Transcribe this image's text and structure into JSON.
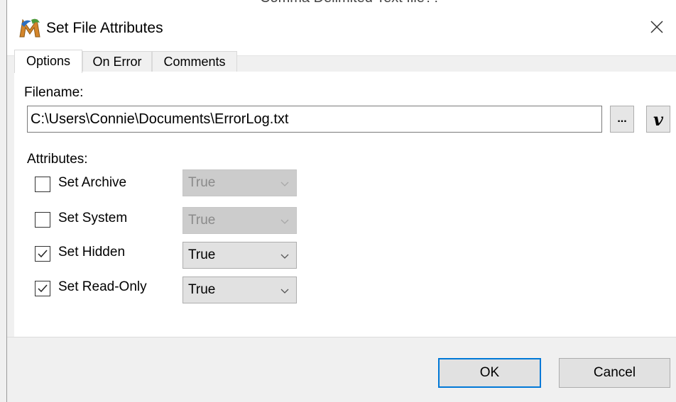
{
  "window": {
    "title": "Set File Attributes",
    "behind_text": "Comma Delimited Text file??"
  },
  "tabs": [
    {
      "label": "Options",
      "active": true
    },
    {
      "label": "On Error",
      "active": false
    },
    {
      "label": "Comments",
      "active": false
    }
  ],
  "filename": {
    "label": "Filename:",
    "value": "C:\\Users\\Connie\\Documents\\ErrorLog.txt",
    "browse_label": "...",
    "variable_label": "v"
  },
  "attributes": {
    "label": "Attributes:",
    "items": [
      {
        "label": "Set Archive",
        "checked": false,
        "value": "True",
        "enabled": false
      },
      {
        "label": "Set System",
        "checked": false,
        "value": "True",
        "enabled": false
      },
      {
        "label": "Set Hidden",
        "checked": true,
        "value": "True",
        "enabled": true
      },
      {
        "label": "Set Read-Only",
        "checked": true,
        "value": "True",
        "enabled": true
      }
    ]
  },
  "buttons": {
    "ok": "OK",
    "cancel": "Cancel"
  },
  "colors": {
    "accent": "#0078d7",
    "disabled_select": "#cccccc",
    "button_face": "#e1e1e1"
  }
}
